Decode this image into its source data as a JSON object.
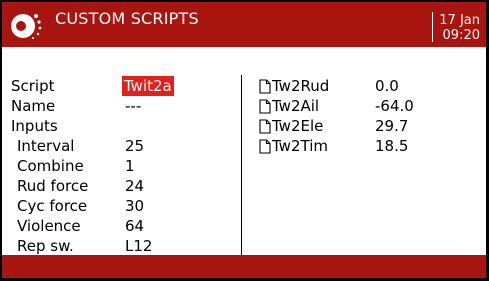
{
  "header": {
    "title": "CUSTOM SCRIPTS",
    "date": "17 Jan",
    "time": "09:20"
  },
  "left": {
    "rows": [
      {
        "label": "Script",
        "value": "Twit2a",
        "highlight": true,
        "indent": false
      },
      {
        "label": "Name",
        "value": "---",
        "highlight": false,
        "indent": false
      },
      {
        "label": "Inputs",
        "value": "",
        "highlight": false,
        "indent": false
      },
      {
        "label": "Interval",
        "value": "25",
        "highlight": false,
        "indent": true
      },
      {
        "label": "Combine",
        "value": "1",
        "highlight": false,
        "indent": true
      },
      {
        "label": "Rud force",
        "value": "24",
        "highlight": false,
        "indent": true
      },
      {
        "label": "Cyc force",
        "value": "30",
        "highlight": false,
        "indent": true
      },
      {
        "label": "Violence",
        "value": "64",
        "highlight": false,
        "indent": true
      },
      {
        "label": "Rep sw.",
        "value": "L12",
        "highlight": false,
        "indent": true
      }
    ]
  },
  "right": {
    "rows": [
      {
        "label": "Tw2Rud",
        "value": "0.0"
      },
      {
        "label": "Tw2Ail",
        "value": "-64.0"
      },
      {
        "label": "Tw2Ele",
        "value": "29.7"
      },
      {
        "label": "Tw2Tim",
        "value": "18.5"
      }
    ]
  },
  "colors": {
    "header": "#a8140f",
    "highlight": "#e0221b"
  },
  "icons": {
    "logo": "radio-logo-icon",
    "output": "file-icon"
  }
}
